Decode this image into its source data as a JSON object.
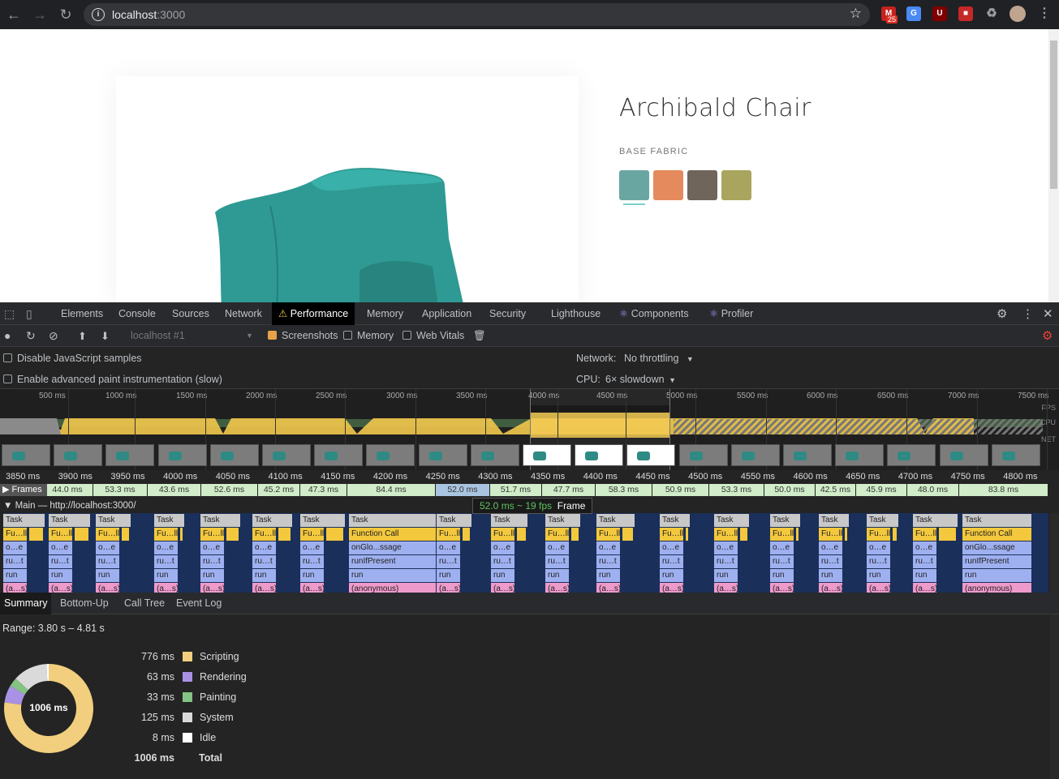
{
  "browser": {
    "url_host": "localhost",
    "url_port": ":3000",
    "gmail_badge": "25"
  },
  "product": {
    "title": "Archibald Chair",
    "label": "BASE FABRIC",
    "swatches": [
      "#6aa6a1",
      "#e48a5d",
      "#6f655b",
      "#a9a55f"
    ]
  },
  "devtools": {
    "tabs": [
      "Elements",
      "Console",
      "Sources",
      "Network",
      "Performance",
      "Memory",
      "Application",
      "Security",
      "Lighthouse",
      "Components",
      "Profiler"
    ],
    "toolbar": {
      "profile": "localhost #1",
      "screenshots": "Screenshots",
      "memory": "Memory",
      "web_vitals": "Web Vitals"
    },
    "settings": {
      "disable_js": "Disable JavaScript samples",
      "adv_paint": "Enable advanced paint instrumentation (slow)",
      "network_label": "Network:",
      "network_value": "No throttling",
      "cpu_label": "CPU:",
      "cpu_value": "6× slowdown"
    },
    "overview_ticks": [
      "500 ms",
      "1000 ms",
      "1500 ms",
      "2000 ms",
      "2500 ms",
      "3000 ms",
      "3500 ms",
      "4000 ms",
      "4500 ms",
      "5000 ms",
      "5500 ms",
      "6000 ms",
      "6500 ms",
      "7000 ms",
      "7500 ms"
    ],
    "overview_labels": [
      "FPS",
      "CPU",
      "NET"
    ],
    "detail_ticks": [
      "3850 ms",
      "3900 ms",
      "3950 ms",
      "4000 ms",
      "4050 ms",
      "4100 ms",
      "4150 ms",
      "4200 ms",
      "4250 ms",
      "4300 ms",
      "4350 ms",
      "4400 ms",
      "4450 ms",
      "4500 ms",
      "4550 ms",
      "4600 ms",
      "4650 ms",
      "4700 ms",
      "4750 ms",
      "4800 ms"
    ],
    "frames_label": "Frames",
    "frames": [
      "44.0 ms",
      "53.3 ms",
      "43.6 ms",
      "52.6 ms",
      "45.2 ms",
      "47.3 ms",
      "84.4 ms",
      "52.0 ms",
      "51.7 ms",
      "47.7 ms",
      "58.3 ms",
      "50.9 ms",
      "53.3 ms",
      "50.0 ms",
      "42.5 ms",
      "45.9 ms",
      "48.0 ms",
      "83.8 ms"
    ],
    "tooltip": {
      "ms": "52.0 ms ~ 19 fps",
      "label": "Frame"
    },
    "main_label": "Main — http://localhost:3000/",
    "flame": {
      "task": "Task",
      "function_call": "Function Call",
      "on_global_message": "onGlo...ssage",
      "run_if_present": "runIfPresent",
      "run": "run",
      "anonymous": "(anonymous)"
    },
    "bottom_tabs": [
      "Summary",
      "Bottom-Up",
      "Call Tree",
      "Event Log"
    ],
    "range": "Range: 3.80 s – 4.81 s",
    "summary": [
      {
        "ms": "776 ms",
        "label": "Scripting",
        "color": "#f2cf7e"
      },
      {
        "ms": "63 ms",
        "label": "Rendering",
        "color": "#a992e4"
      },
      {
        "ms": "33 ms",
        "label": "Painting",
        "color": "#84c383"
      },
      {
        "ms": "125 ms",
        "label": "System",
        "color": "#dadada"
      },
      {
        "ms": "8 ms",
        "label": "Idle",
        "color": "#ffffff"
      },
      {
        "ms": "1006 ms",
        "label": "Total",
        "color": ""
      }
    ],
    "donut_total": "1006 ms"
  }
}
